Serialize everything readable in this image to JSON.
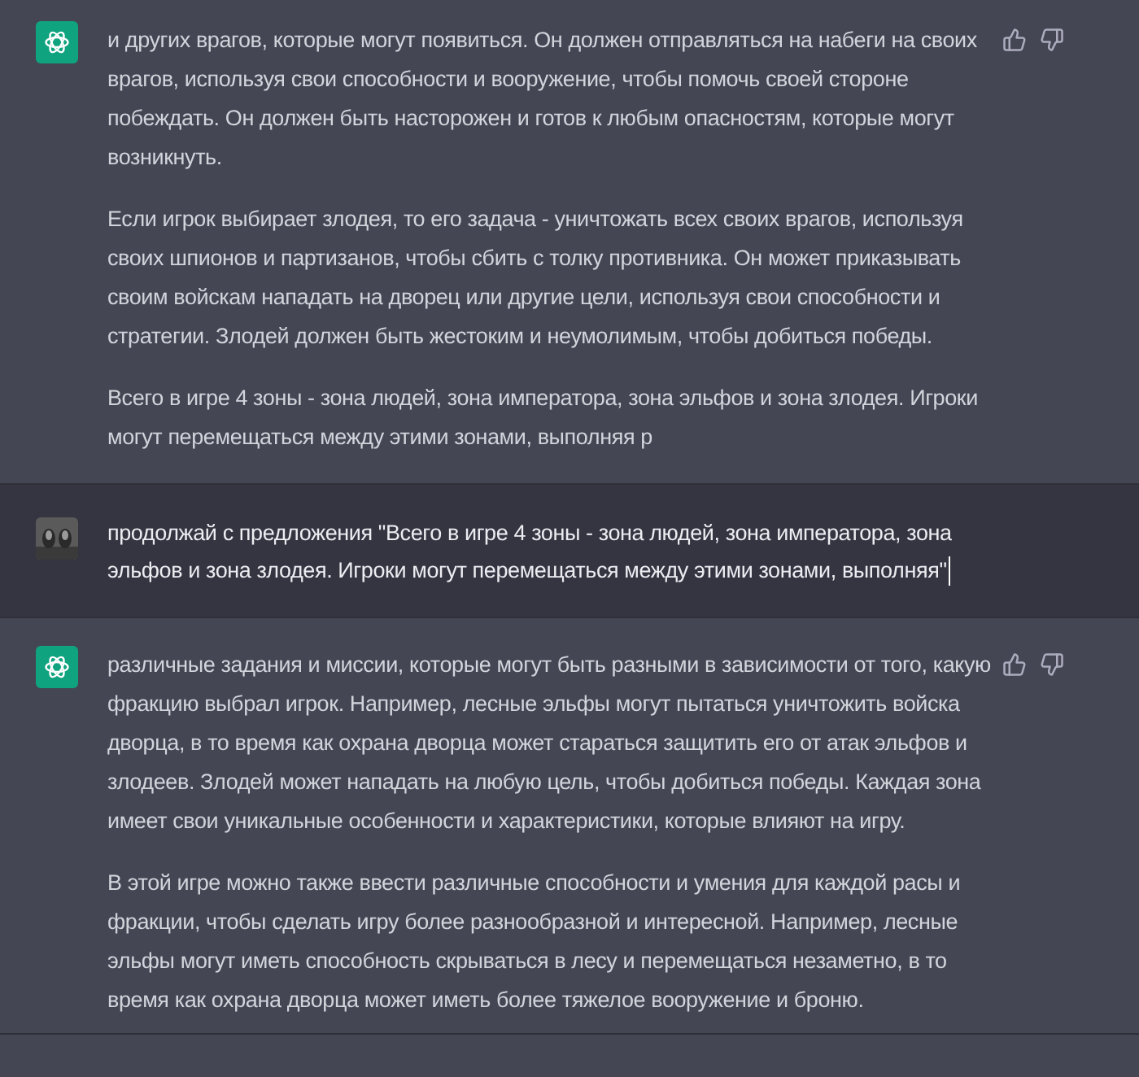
{
  "messages": [
    {
      "kind": "assistant",
      "paragraphs": [
        "и других врагов, которые могут появиться. Он должен отправляться на набеги на своих врагов, используя свои способности и вооружение, чтобы помочь своей стороне побеждать. Он должен быть насторожен и готов к любым опасностям, которые могут возникнуть.",
        "Если игрок выбирает злодея, то его задача - уничтожать всех своих врагов, используя своих шпионов и партизанов, чтобы сбить с толку противника. Он может приказывать своим войскам нападать на дворец или другие цели, используя свои способности и стратегии. Злодей должен быть жестоким и неумолимым, чтобы добиться победы.",
        "Всего в игре 4 зоны - зона людей, зона императора, зона эльфов и зона злодея. Игроки могут перемещаться между этими зонами, выполняя р"
      ]
    },
    {
      "kind": "user",
      "paragraphs": [
        "продолжай с предложения \"Всего в игре 4 зоны - зона людей, зона императора, зона эльфов и зона злодея. Игроки могут перемещаться между этими зонами, выполняя\""
      ]
    },
    {
      "kind": "assistant",
      "paragraphs": [
        "различные задания и миссии, которые могут быть разными в зависимости от того, какую фракцию выбрал игрок. Например, лесные эльфы могут пытаться уничтожить войска дворца, в то время как охрана дворца может стараться защитить его от атак эльфов и злодеев. Злодей может нападать на любую цель, чтобы добиться победы. Каждая зона имеет свои уникальные особенности и характеристики, которые влияют на игру.",
        "В этой игре можно также ввести различные способности и умения для каждой расы и фракции, чтобы сделать игру более разнообразной и интересной. Например, лесные эльфы могут иметь способность скрываться в лесу и перемещаться незаметно, в то время как охрана дворца может иметь более тяжелое вооружение и броню."
      ]
    }
  ]
}
